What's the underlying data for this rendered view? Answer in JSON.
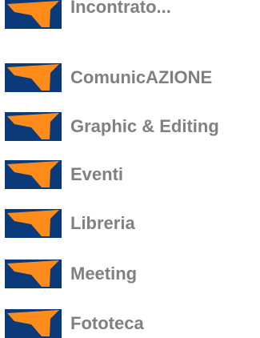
{
  "menu": {
    "items": [
      {
        "label": "Incontrato...",
        "icon": "orange-arrow-icon"
      },
      {
        "label": "ComunicAZIONE",
        "icon": "orange-arrow-icon"
      },
      {
        "label": "Graphic & Editing",
        "icon": "orange-arrow-icon"
      },
      {
        "label": "Eventi",
        "icon": "orange-arrow-icon"
      },
      {
        "label": "Libreria",
        "icon": "orange-arrow-icon"
      },
      {
        "label": "Meeting",
        "icon": "orange-arrow-icon"
      },
      {
        "label": "Fototeca",
        "icon": "orange-arrow-icon"
      }
    ]
  },
  "colors": {
    "icon_background": "#0a3a7a",
    "icon_arrow": "#ff8c1a",
    "label_text": "#808080"
  }
}
